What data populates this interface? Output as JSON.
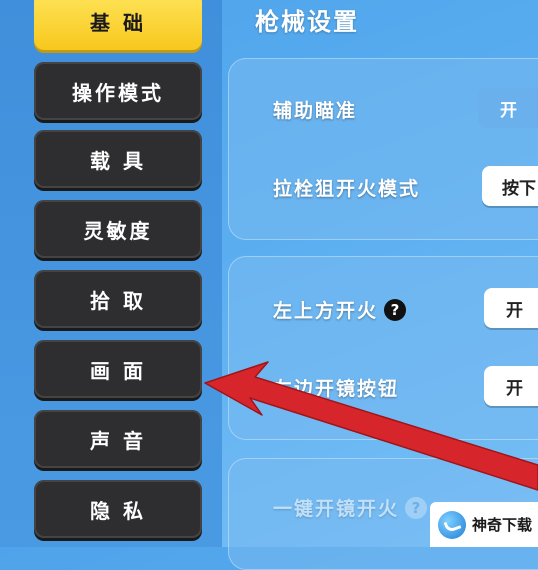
{
  "sidebar": {
    "items": [
      {
        "label": "基 础",
        "active": true
      },
      {
        "label": "操作模式",
        "active": false
      },
      {
        "label": "载 具",
        "active": false
      },
      {
        "label": "灵敏度",
        "active": false
      },
      {
        "label": "拾 取",
        "active": false
      },
      {
        "label": "画 面",
        "active": false
      },
      {
        "label": "声 音",
        "active": false
      },
      {
        "label": "隐 私",
        "active": false
      }
    ]
  },
  "main": {
    "section_title": "枪械设置",
    "rows": [
      {
        "label": "辅助瞄准",
        "value": "开"
      },
      {
        "label": "拉栓狙开火模式",
        "value": "按下"
      },
      {
        "label": "左上方开火",
        "value": "开"
      },
      {
        "label": "左边开镜按钮",
        "value": "开"
      },
      {
        "label": "一键开镜开火",
        "value": ""
      }
    ],
    "help_symbol": "?"
  },
  "watermark": {
    "text": "神奇下载"
  },
  "colors": {
    "accent_yellow": "#f7c81d",
    "button_dark": "#2e2e30",
    "arrow_red": "#d6262b",
    "background_blue": "#5aaef0"
  }
}
